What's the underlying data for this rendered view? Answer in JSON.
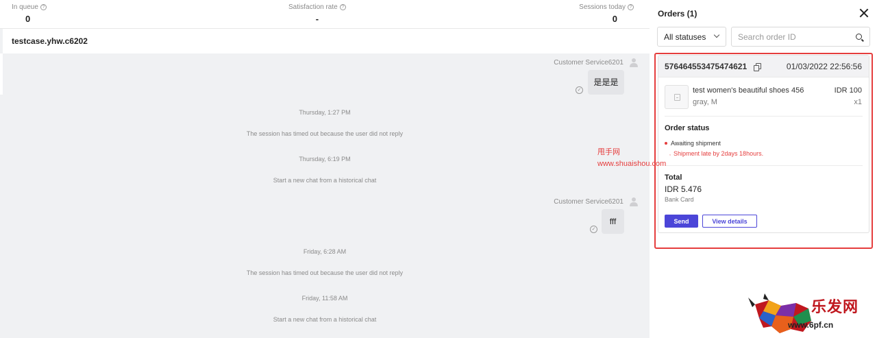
{
  "stats": {
    "in_queue": {
      "label": "In queue",
      "value": "0"
    },
    "satisfaction": {
      "label": "Satisfaction rate",
      "value": "-"
    },
    "sessions_today": {
      "label": "Sessions today",
      "value": "0"
    }
  },
  "session": {
    "title": "testcase.yhw.c6202"
  },
  "chat": {
    "message1": {
      "sender": "Customer Service6201",
      "text": "是是是"
    },
    "system1": {
      "time": "Thursday, 1:27 PM",
      "text": "The session has timed out because the user did not reply"
    },
    "system2": {
      "time": "Thursday, 6:19 PM",
      "text": "Start a new chat from a historical chat"
    },
    "message2": {
      "sender": "Customer Service6201",
      "text": "fff"
    },
    "system3": {
      "time": "Friday, 6:28 AM",
      "text": "The session has timed out because the user did not reply"
    },
    "system4": {
      "time": "Friday, 11:58 AM",
      "text": "Start a new chat from a historical chat"
    }
  },
  "orders_panel": {
    "title": "Orders (1)",
    "status_filter": "All statuses",
    "search_placeholder": "Search order ID",
    "order": {
      "id": "576464553475474621",
      "date": "01/03/2022 22:56:56",
      "product_name": "test women's beautiful shoes 456",
      "variant": "gray, M",
      "price": "IDR 100",
      "quantity": "x1",
      "status_heading": "Order status",
      "status": "Awaiting shipment",
      "late_note": "Shipment late by 2days 18hours.",
      "total_heading": "Total",
      "total_amount": "IDR 5.476",
      "payment_method": "Bank Card",
      "send_label": "Send",
      "details_label": "View details"
    }
  },
  "watermarks": {
    "site_name": "甩手网",
    "site_url": "www.shuaishou.com",
    "logo_text": "乐发网",
    "logo_url": "www.6pf.cn"
  },
  "colors": {
    "accent": "#4b45d8",
    "alert": "#e53d3d"
  }
}
